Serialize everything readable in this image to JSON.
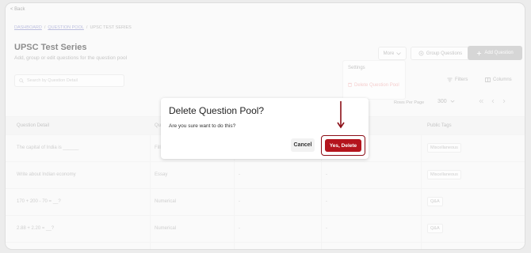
{
  "nav": {
    "back_label": "< Back"
  },
  "breadcrumb": {
    "home": "DASHBOARD",
    "sep1": "/",
    "pool": "QUESTION POOL",
    "sep2": "/",
    "current": "UPSC TEST SERIES"
  },
  "page": {
    "title": "UPSC Test Series",
    "subtitle": "Add, group or edit questions for the question pool"
  },
  "header_actions": {
    "more_label": "More",
    "group_label": "Group Questions",
    "add_label": "Add Question"
  },
  "more_menu": {
    "settings_label": "Settings",
    "delete_label": "Delete Question Pool"
  },
  "toolbar": {
    "search_placeholder": "Search by Question Detail",
    "filters_label": "Filters",
    "columns_label": "Columns"
  },
  "pagination": {
    "rows_per_page_label": "Rows Per Page",
    "rows_per_page_value": "300"
  },
  "table": {
    "headers": [
      "Question Detail",
      "Question Type",
      "",
      "",
      "Public Tags"
    ],
    "rows": [
      {
        "detail": "The capital of India is ______",
        "type": "Fill",
        "c3": "-",
        "c4": "-",
        "tag": "Miscellaneous"
      },
      {
        "detail": "Write about Indian economy",
        "type": "Essay",
        "c3": "-",
        "c4": "-",
        "tag": "Miscellaneous"
      },
      {
        "detail": "170 + 200 - 70 = __?",
        "type": "Numerical",
        "c3": "-",
        "c4": "-",
        "tag": "Q&A"
      },
      {
        "detail": "2.88 + 2.20 = __?",
        "type": "Numerical",
        "c3": "-",
        "c4": "-",
        "tag": "Q&A"
      }
    ]
  },
  "modal": {
    "title": "Delete Question Pool?",
    "message": "Are you sure want to do this?",
    "cancel_label": "Cancel",
    "confirm_label": "Yes, Delete"
  },
  "colors": {
    "danger": "#b4141d",
    "danger_outline": "#8b0d16",
    "annotation_arrow": "#8b0d16"
  }
}
